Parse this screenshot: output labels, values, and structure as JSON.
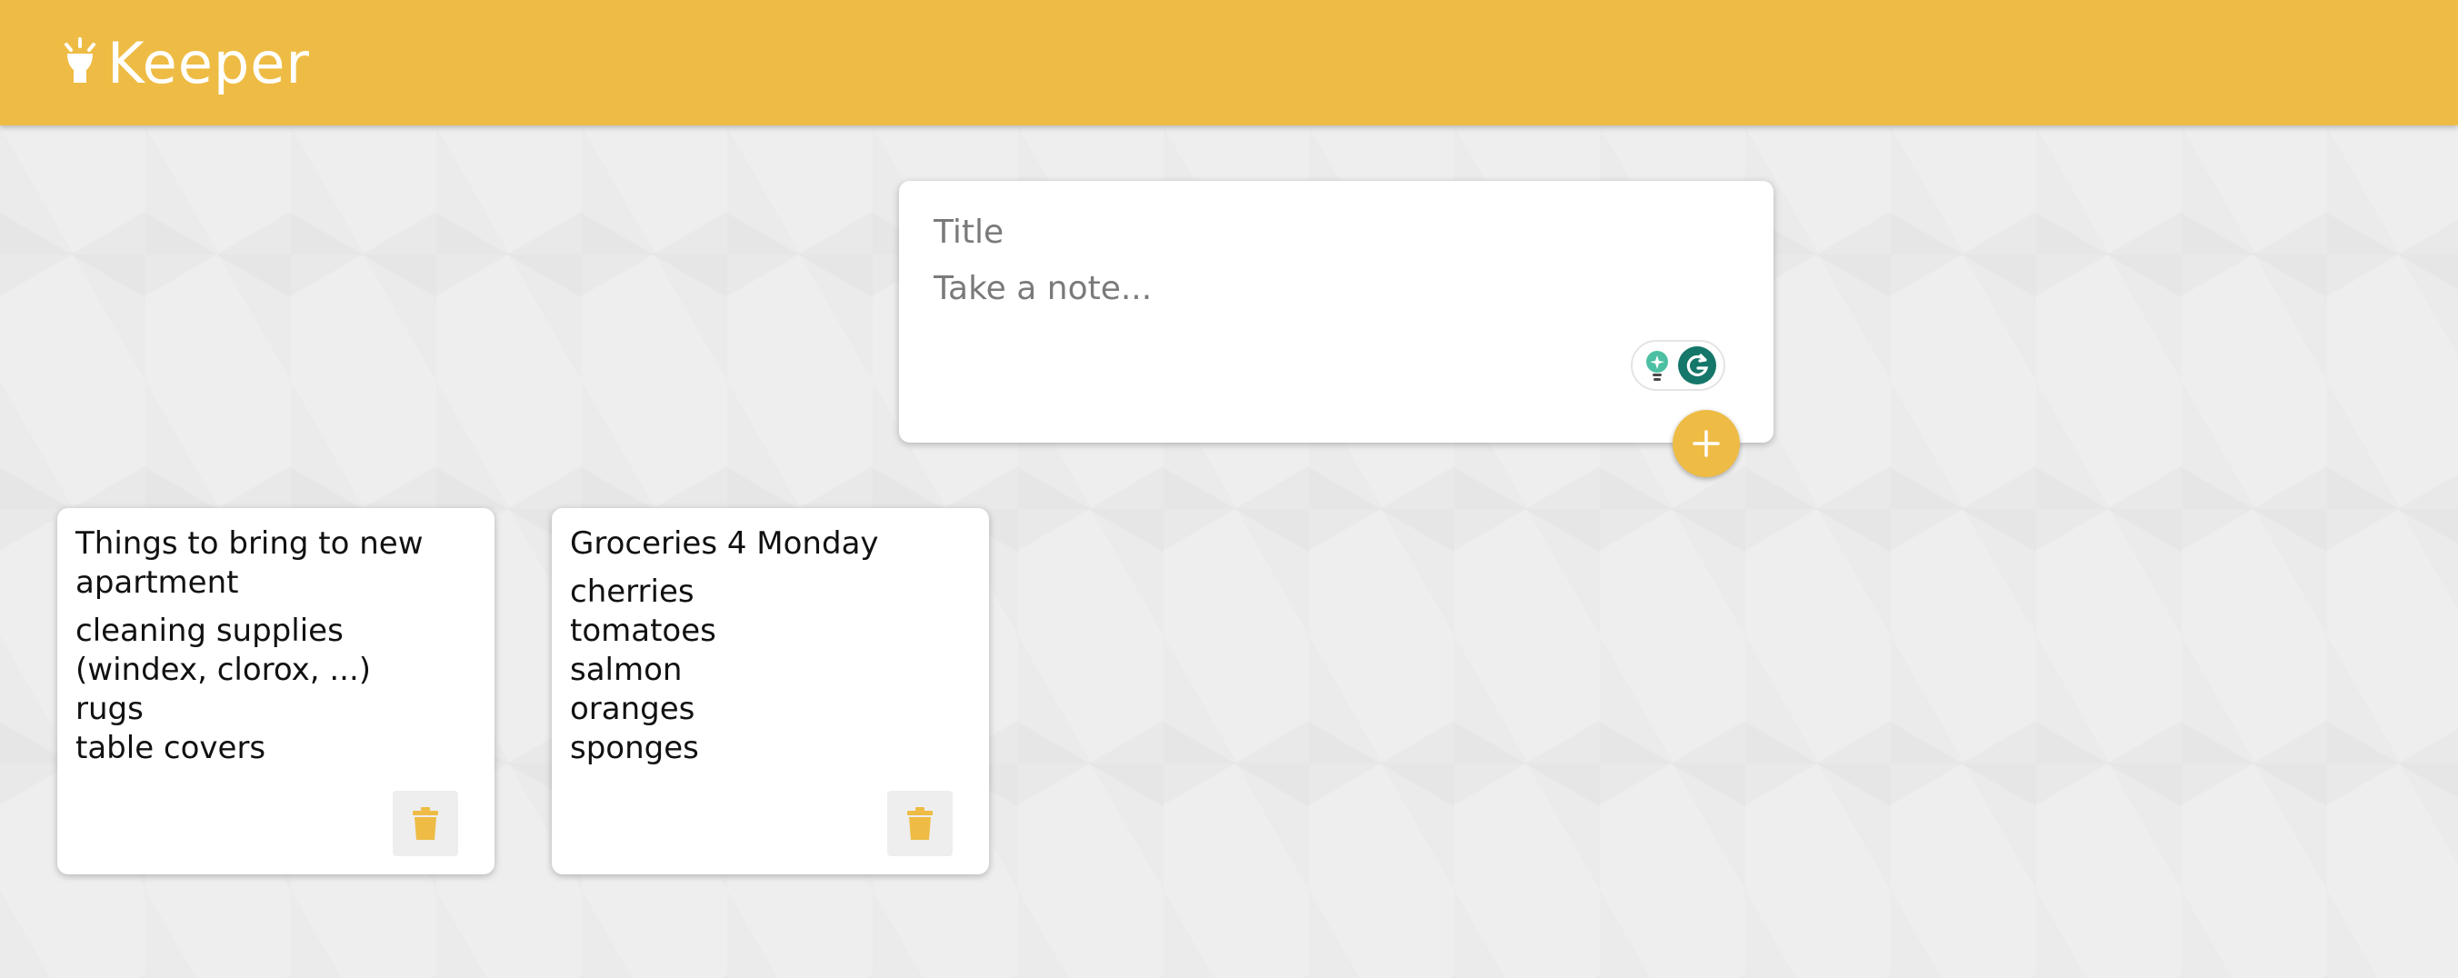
{
  "app": {
    "name": "Keeper",
    "accent_color": "#eebc45",
    "logo_icon": "lightbulb-icon"
  },
  "create_note": {
    "title_placeholder": "Title",
    "content_placeholder": "Take a note...",
    "title_value": "",
    "content_value": "",
    "add_icon": "plus-icon",
    "grammarly_icons": [
      "lightbulb-icon",
      "grammarly-icon"
    ]
  },
  "notes": [
    {
      "title": "Things to bring to new apartment",
      "title_lines": [
        "Things to bring to new",
        "apartment"
      ],
      "content_lines": [
        "cleaning supplies",
        "(windex, clorox, ...)",
        "rugs",
        "table covers"
      ],
      "delete_icon": "trash-icon"
    },
    {
      "title": "Groceries 4 Monday",
      "title_lines": [
        "Groceries 4 Monday"
      ],
      "content_lines": [
        "cherries",
        "tomatoes",
        "salmon",
        "oranges",
        "sponges"
      ],
      "delete_icon": "trash-icon"
    }
  ]
}
